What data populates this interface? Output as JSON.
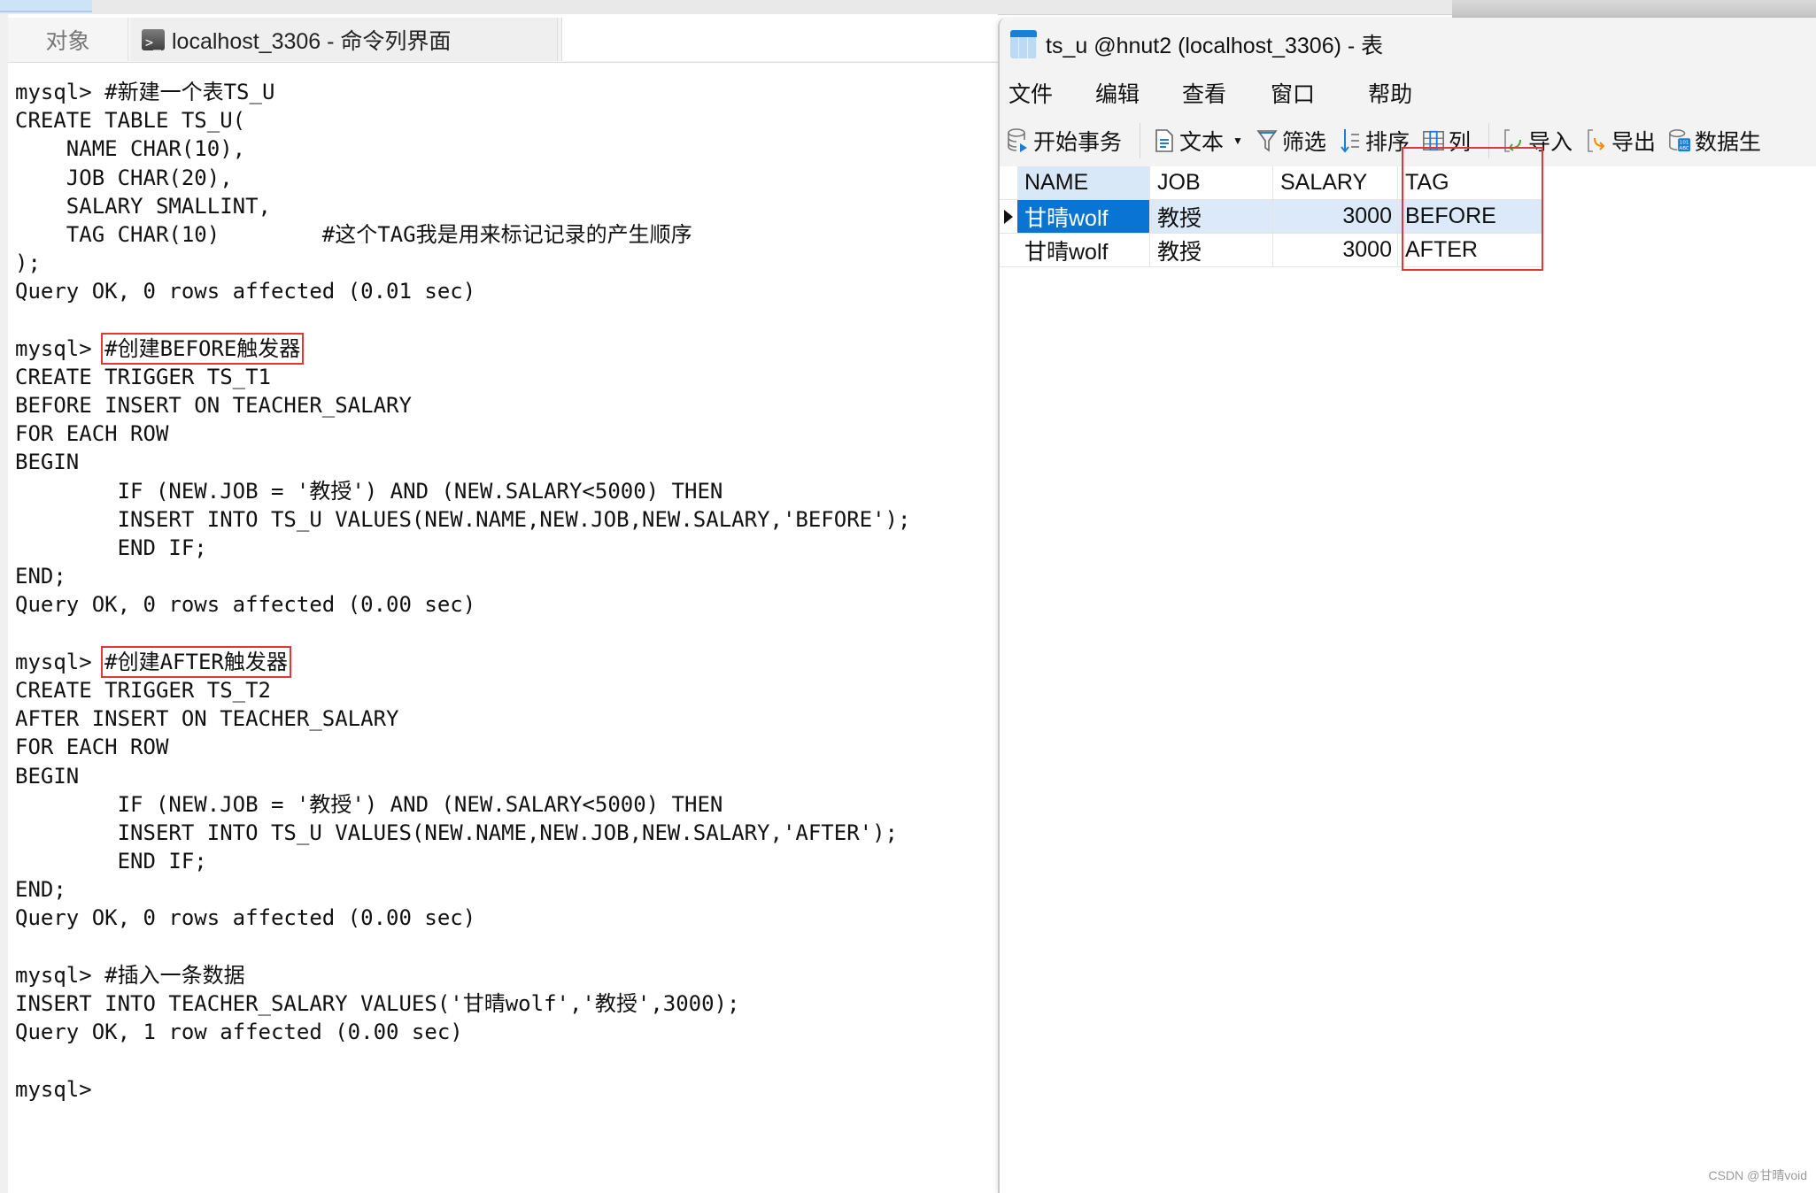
{
  "left_panel": {
    "tabs": [
      {
        "label": "对象",
        "active": false
      },
      {
        "label": "localhost_3306 - 命令列界面",
        "active": true,
        "icon": "terminal-icon"
      }
    ],
    "terminal_lines": [
      {
        "text": "mysql> #新建一个表TS_U"
      },
      {
        "text": "CREATE TABLE TS_U("
      },
      {
        "text": "    NAME CHAR(10),"
      },
      {
        "text": "    JOB CHAR(20),"
      },
      {
        "text": "    SALARY SMALLINT,"
      },
      {
        "text": "    TAG CHAR(10)        #这个TAG我是用来标记记录的产生顺序"
      },
      {
        "text": ");"
      },
      {
        "text": "Query OK, 0 rows affected (0.01 sec)"
      },
      {
        "text": ""
      },
      {
        "prompt": "mysql> ",
        "text": "#创建BEFORE触发器",
        "highlighted": true
      },
      {
        "text": "CREATE TRIGGER TS_T1"
      },
      {
        "text": "BEFORE INSERT ON TEACHER_SALARY"
      },
      {
        "text": "FOR EACH ROW"
      },
      {
        "text": "BEGIN"
      },
      {
        "text": "        IF (NEW.JOB = '教授') AND (NEW.SALARY<5000) THEN"
      },
      {
        "text": "        INSERT INTO TS_U VALUES(NEW.NAME,NEW.JOB,NEW.SALARY,'BEFORE');"
      },
      {
        "text": "        END IF;"
      },
      {
        "text": "END;"
      },
      {
        "text": "Query OK, 0 rows affected (0.00 sec)"
      },
      {
        "text": ""
      },
      {
        "prompt": "mysql> ",
        "text": "#创建AFTER触发器",
        "highlighted": true
      },
      {
        "text": "CREATE TRIGGER TS_T2"
      },
      {
        "text": "AFTER INSERT ON TEACHER_SALARY"
      },
      {
        "text": "FOR EACH ROW"
      },
      {
        "text": "BEGIN"
      },
      {
        "text": "        IF (NEW.JOB = '教授') AND (NEW.SALARY<5000) THEN"
      },
      {
        "text": "        INSERT INTO TS_U VALUES(NEW.NAME,NEW.JOB,NEW.SALARY,'AFTER');"
      },
      {
        "text": "        END IF;"
      },
      {
        "text": "END;"
      },
      {
        "text": "Query OK, 0 rows affected (0.00 sec)"
      },
      {
        "text": ""
      },
      {
        "text": "mysql> #插入一条数据"
      },
      {
        "text": "INSERT INTO TEACHER_SALARY VALUES('甘晴wolf','教授',3000);"
      },
      {
        "text": "Query OK, 1 row affected (0.00 sec)"
      },
      {
        "text": ""
      },
      {
        "text": "mysql>"
      }
    ]
  },
  "right_window": {
    "title": "ts_u @hnut2 (localhost_3306) - 表",
    "menu": [
      "文件",
      "编辑",
      "查看",
      "窗口",
      "帮助"
    ],
    "toolbar": {
      "begin_transaction": "开始事务",
      "text": "文本",
      "filter": "筛选",
      "sort": "排序",
      "columns": "列",
      "import": "导入",
      "export": "导出",
      "data_generation": "数据生"
    },
    "grid": {
      "columns": [
        "NAME",
        "JOB",
        "SALARY",
        "TAG"
      ],
      "rows": [
        {
          "NAME": "甘晴wolf",
          "JOB": "教授",
          "SALARY": "3000",
          "TAG": "BEFORE",
          "selected": true
        },
        {
          "NAME": "甘晴wolf",
          "JOB": "教授",
          "SALARY": "3000",
          "TAG": "AFTER",
          "selected": false
        }
      ]
    }
  },
  "colors": {
    "highlight_box": "#e2373a",
    "selected_cell": "#0a74d4",
    "selected_row": "#dbe9f8"
  },
  "watermark": "CSDN @甘晴void"
}
